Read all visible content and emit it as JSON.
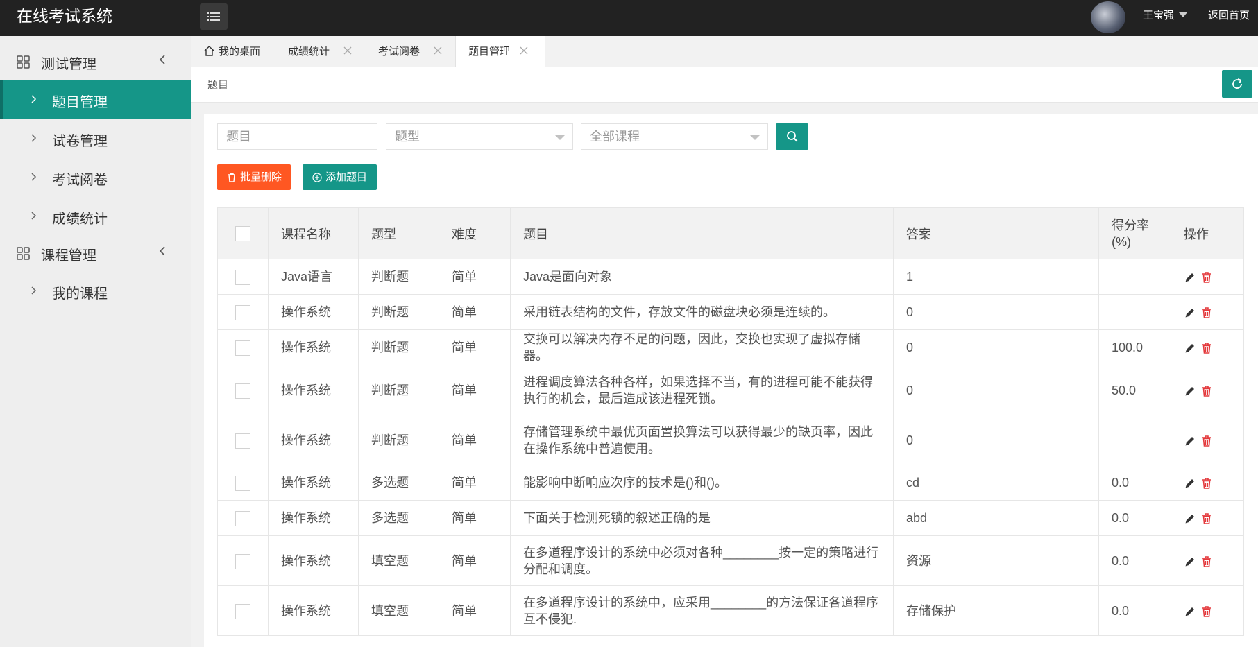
{
  "header": {
    "app_title": "在线考试系统",
    "username": "王宝强",
    "home_link": "返回首页"
  },
  "sidebar": {
    "groups": [
      {
        "label": "测试管理",
        "items": [
          {
            "label": "题目管理",
            "active": true
          },
          {
            "label": "试卷管理"
          },
          {
            "label": "考试阅卷"
          },
          {
            "label": "成绩统计"
          }
        ]
      },
      {
        "label": "课程管理",
        "items": [
          {
            "label": "我的课程"
          }
        ]
      }
    ]
  },
  "tabs": [
    {
      "label": "我的桌面",
      "closable": false
    },
    {
      "label": "成绩统计",
      "closable": true
    },
    {
      "label": "考试阅卷",
      "closable": true
    },
    {
      "label": "题目管理",
      "closable": true,
      "active": true
    }
  ],
  "breadcrumb": "题目",
  "filters": {
    "question_placeholder": "题目",
    "type_select": "题型",
    "course_select": "全部课程"
  },
  "actions": {
    "batch_delete": "批量删除",
    "add_question": "添加题目"
  },
  "table": {
    "headers": [
      "课程名称",
      "题型",
      "难度",
      "题目",
      "答案",
      "得分率\n(%)",
      "操作"
    ],
    "rows": [
      {
        "course": "Java语言",
        "type": "判断题",
        "difficulty": "简单",
        "question": "Java是面向对象",
        "answer": "1",
        "rate": ""
      },
      {
        "course": "操作系统",
        "type": "判断题",
        "difficulty": "简单",
        "question": "采用链表结构的文件，存放文件的磁盘块必须是连续的。",
        "answer": "0",
        "rate": ""
      },
      {
        "course": "操作系统",
        "type": "判断题",
        "difficulty": "简单",
        "question": "交换可以解决内存不足的问题，因此，交换也实现了虚拟存储器。",
        "answer": "0",
        "rate": "100.0"
      },
      {
        "course": "操作系统",
        "type": "判断题",
        "difficulty": "简单",
        "question": "进程调度算法各种各样，如果选择不当，有的进程可能不能获得执行的机会，最后造成该进程死锁。",
        "answer": "0",
        "rate": "50.0"
      },
      {
        "course": "操作系统",
        "type": "判断题",
        "difficulty": "简单",
        "question": "存储管理系统中最优页面置换算法可以获得最少的缺页率，因此在操作系统中普遍使用。",
        "answer": "0",
        "rate": ""
      },
      {
        "course": "操作系统",
        "type": "多选题",
        "difficulty": "简单",
        "question": "能影响中断响应次序的技术是()和()。",
        "answer": "cd",
        "rate": "0.0"
      },
      {
        "course": "操作系统",
        "type": "多选题",
        "difficulty": "简单",
        "question": "下面关于检测死锁的叙述正确的是",
        "answer": "abd",
        "rate": "0.0"
      },
      {
        "course": "操作系统",
        "type": "填空题",
        "difficulty": "简单",
        "question": "在多道程序设计的系统中必须对各种________按一定的策略进行分配和调度。",
        "answer": "资源",
        "rate": "0.0"
      },
      {
        "course": "操作系统",
        "type": "填空题",
        "difficulty": "简单",
        "question": "在多道程序设计的系统中，应采用________的方法保证各道程序互不侵犯.",
        "answer": "存储保护",
        "rate": "0.0"
      }
    ]
  },
  "colors": {
    "primary": "#159688",
    "danger": "#ff5722",
    "header_bg": "#222222",
    "delete_icon": "#e4393c"
  },
  "icons": {
    "menu_toggle": "hamburger-icon",
    "group": "grid-icon",
    "search": "search-icon",
    "refresh": "refresh-icon",
    "edit": "pencil-icon",
    "delete": "trash-icon"
  }
}
